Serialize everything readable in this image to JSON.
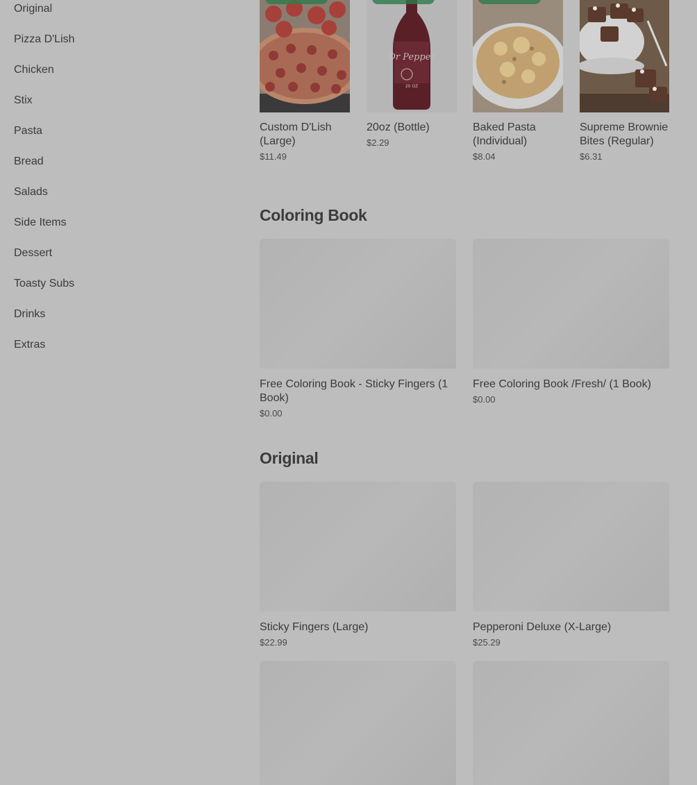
{
  "sidebar": {
    "items": [
      {
        "label": "Original"
      },
      {
        "label": "Pizza D'Lish"
      },
      {
        "label": "Chicken"
      },
      {
        "label": "Stix"
      },
      {
        "label": "Pasta"
      },
      {
        "label": "Bread"
      },
      {
        "label": "Salads"
      },
      {
        "label": "Side Items"
      },
      {
        "label": "Dessert"
      },
      {
        "label": "Toasty Subs"
      },
      {
        "label": "Drinks"
      },
      {
        "label": "Extras"
      }
    ]
  },
  "featured": {
    "items": [
      {
        "name": "Custom D'Lish (Large)",
        "price": "$11.49",
        "image": "pepperoni-pizza-image"
      },
      {
        "name": "20oz (Bottle)",
        "price": "$2.29",
        "image": "dr-pepper-bottle-image",
        "bottle_label": "Dr Pepper",
        "bottle_size": "20 OZ"
      },
      {
        "name": "Baked Pasta (Individual)",
        "price": "$8.04",
        "image": "baked-pasta-image"
      },
      {
        "name": "Supreme Brownie Bites (Regular)",
        "price": "$6.31",
        "image": "brownie-bites-image"
      }
    ]
  },
  "coloring_book": {
    "title": "Coloring Book",
    "items": [
      {
        "name": "Free Coloring Book - Sticky Fingers (1 Book)",
        "price": "$0.00"
      },
      {
        "name": "Free Coloring Book /Fresh/ (1 Book)",
        "price": "$0.00"
      }
    ]
  },
  "original": {
    "title": "Original",
    "items": [
      {
        "name": "Sticky Fingers (Large)",
        "price": "$22.99"
      },
      {
        "name": "Pepperoni Deluxe (X-Large)",
        "price": "$25.29"
      }
    ]
  },
  "colors": {
    "overlay_background": "#bdbdbd",
    "placeholder": "#b5b5b5",
    "badge_green": "#2f7a4a"
  }
}
